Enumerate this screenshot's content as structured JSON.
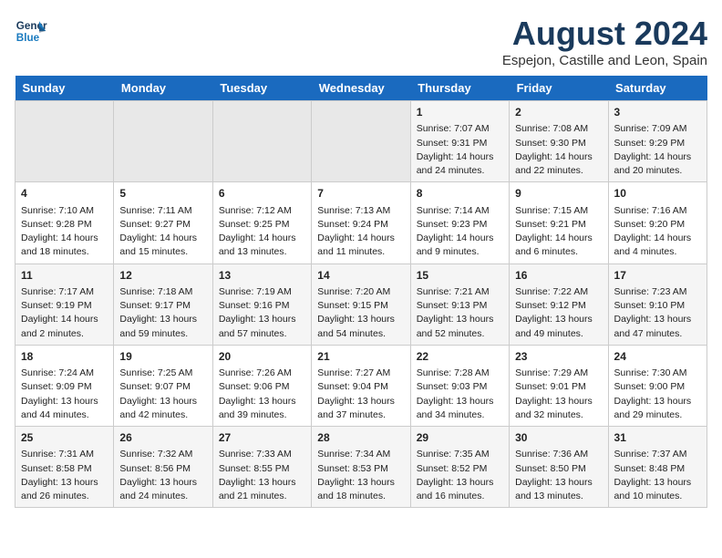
{
  "header": {
    "logo_line1": "General",
    "logo_line2": "Blue",
    "month_year": "August 2024",
    "location": "Espejon, Castille and Leon, Spain"
  },
  "weekdays": [
    "Sunday",
    "Monday",
    "Tuesday",
    "Wednesday",
    "Thursday",
    "Friday",
    "Saturday"
  ],
  "weeks": [
    [
      {
        "day": "",
        "content": ""
      },
      {
        "day": "",
        "content": ""
      },
      {
        "day": "",
        "content": ""
      },
      {
        "day": "",
        "content": ""
      },
      {
        "day": "1",
        "content": "Sunrise: 7:07 AM\nSunset: 9:31 PM\nDaylight: 14 hours\nand 24 minutes."
      },
      {
        "day": "2",
        "content": "Sunrise: 7:08 AM\nSunset: 9:30 PM\nDaylight: 14 hours\nand 22 minutes."
      },
      {
        "day": "3",
        "content": "Sunrise: 7:09 AM\nSunset: 9:29 PM\nDaylight: 14 hours\nand 20 minutes."
      }
    ],
    [
      {
        "day": "4",
        "content": "Sunrise: 7:10 AM\nSunset: 9:28 PM\nDaylight: 14 hours\nand 18 minutes."
      },
      {
        "day": "5",
        "content": "Sunrise: 7:11 AM\nSunset: 9:27 PM\nDaylight: 14 hours\nand 15 minutes."
      },
      {
        "day": "6",
        "content": "Sunrise: 7:12 AM\nSunset: 9:25 PM\nDaylight: 14 hours\nand 13 minutes."
      },
      {
        "day": "7",
        "content": "Sunrise: 7:13 AM\nSunset: 9:24 PM\nDaylight: 14 hours\nand 11 minutes."
      },
      {
        "day": "8",
        "content": "Sunrise: 7:14 AM\nSunset: 9:23 PM\nDaylight: 14 hours\nand 9 minutes."
      },
      {
        "day": "9",
        "content": "Sunrise: 7:15 AM\nSunset: 9:21 PM\nDaylight: 14 hours\nand 6 minutes."
      },
      {
        "day": "10",
        "content": "Sunrise: 7:16 AM\nSunset: 9:20 PM\nDaylight: 14 hours\nand 4 minutes."
      }
    ],
    [
      {
        "day": "11",
        "content": "Sunrise: 7:17 AM\nSunset: 9:19 PM\nDaylight: 14 hours\nand 2 minutes."
      },
      {
        "day": "12",
        "content": "Sunrise: 7:18 AM\nSunset: 9:17 PM\nDaylight: 13 hours\nand 59 minutes."
      },
      {
        "day": "13",
        "content": "Sunrise: 7:19 AM\nSunset: 9:16 PM\nDaylight: 13 hours\nand 57 minutes."
      },
      {
        "day": "14",
        "content": "Sunrise: 7:20 AM\nSunset: 9:15 PM\nDaylight: 13 hours\nand 54 minutes."
      },
      {
        "day": "15",
        "content": "Sunrise: 7:21 AM\nSunset: 9:13 PM\nDaylight: 13 hours\nand 52 minutes."
      },
      {
        "day": "16",
        "content": "Sunrise: 7:22 AM\nSunset: 9:12 PM\nDaylight: 13 hours\nand 49 minutes."
      },
      {
        "day": "17",
        "content": "Sunrise: 7:23 AM\nSunset: 9:10 PM\nDaylight: 13 hours\nand 47 minutes."
      }
    ],
    [
      {
        "day": "18",
        "content": "Sunrise: 7:24 AM\nSunset: 9:09 PM\nDaylight: 13 hours\nand 44 minutes."
      },
      {
        "day": "19",
        "content": "Sunrise: 7:25 AM\nSunset: 9:07 PM\nDaylight: 13 hours\nand 42 minutes."
      },
      {
        "day": "20",
        "content": "Sunrise: 7:26 AM\nSunset: 9:06 PM\nDaylight: 13 hours\nand 39 minutes."
      },
      {
        "day": "21",
        "content": "Sunrise: 7:27 AM\nSunset: 9:04 PM\nDaylight: 13 hours\nand 37 minutes."
      },
      {
        "day": "22",
        "content": "Sunrise: 7:28 AM\nSunset: 9:03 PM\nDaylight: 13 hours\nand 34 minutes."
      },
      {
        "day": "23",
        "content": "Sunrise: 7:29 AM\nSunset: 9:01 PM\nDaylight: 13 hours\nand 32 minutes."
      },
      {
        "day": "24",
        "content": "Sunrise: 7:30 AM\nSunset: 9:00 PM\nDaylight: 13 hours\nand 29 minutes."
      }
    ],
    [
      {
        "day": "25",
        "content": "Sunrise: 7:31 AM\nSunset: 8:58 PM\nDaylight: 13 hours\nand 26 minutes."
      },
      {
        "day": "26",
        "content": "Sunrise: 7:32 AM\nSunset: 8:56 PM\nDaylight: 13 hours\nand 24 minutes."
      },
      {
        "day": "27",
        "content": "Sunrise: 7:33 AM\nSunset: 8:55 PM\nDaylight: 13 hours\nand 21 minutes."
      },
      {
        "day": "28",
        "content": "Sunrise: 7:34 AM\nSunset: 8:53 PM\nDaylight: 13 hours\nand 18 minutes."
      },
      {
        "day": "29",
        "content": "Sunrise: 7:35 AM\nSunset: 8:52 PM\nDaylight: 13 hours\nand 16 minutes."
      },
      {
        "day": "30",
        "content": "Sunrise: 7:36 AM\nSunset: 8:50 PM\nDaylight: 13 hours\nand 13 minutes."
      },
      {
        "day": "31",
        "content": "Sunrise: 7:37 AM\nSunset: 8:48 PM\nDaylight: 13 hours\nand 10 minutes."
      }
    ]
  ]
}
